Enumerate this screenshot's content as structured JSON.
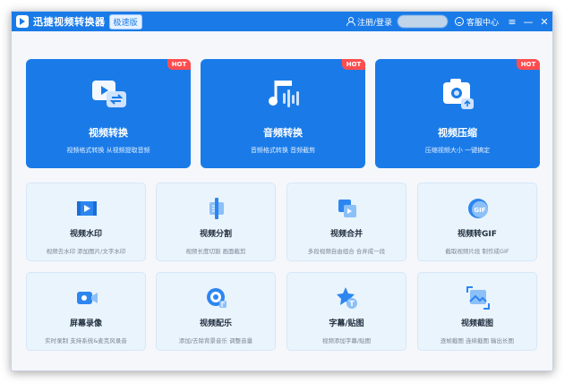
{
  "titlebar": {
    "app_title": "迅捷视频转换器",
    "edition": "极速版",
    "login_label": "注册/登录",
    "service_label": "客服中心",
    "menu_glyph": "≡",
    "minimize_glyph": "—",
    "close_glyph": "✕"
  },
  "hot_label": "HOT",
  "big_cards": [
    {
      "title": "视频转换",
      "subtitle": "视频格式转换 从视频提取音频",
      "icon": "video-convert-icon"
    },
    {
      "title": "音频转换",
      "subtitle": "音频格式转换 音频截剪",
      "icon": "audio-convert-icon"
    },
    {
      "title": "视频压缩",
      "subtitle": "压缩视频大小 一键搞定",
      "icon": "video-compress-icon"
    }
  ],
  "tools": [
    {
      "title": "视频水印",
      "subtitle": "视频去水印 添加图片/文字水印",
      "icon": "watermark-icon"
    },
    {
      "title": "视频分割",
      "subtitle": "视频长度切割 画面截剪",
      "icon": "split-icon"
    },
    {
      "title": "视频合并",
      "subtitle": "多段视频自由组合 合并成一段",
      "icon": "merge-icon"
    },
    {
      "title": "视频转GIF",
      "subtitle": "截取视频片段 制作成GIF",
      "icon": "gif-icon"
    },
    {
      "title": "屏幕录像",
      "subtitle": "实时录制 支持系统&麦克风录音",
      "icon": "screen-record-icon"
    },
    {
      "title": "视频配乐",
      "subtitle": "添加/去除背景音乐 调整音量",
      "icon": "music-icon"
    },
    {
      "title": "字幕/贴图",
      "subtitle": "视频添加字幕/贴图",
      "icon": "subtitle-sticker-icon"
    },
    {
      "title": "视频截图",
      "subtitle": "逐帧截图 连续截图 输出长图",
      "icon": "screenshot-icon"
    }
  ],
  "colors": {
    "accent": "#1a7be8",
    "hot": "#ff4d4f",
    "card_bg": "#eaf4fd"
  }
}
